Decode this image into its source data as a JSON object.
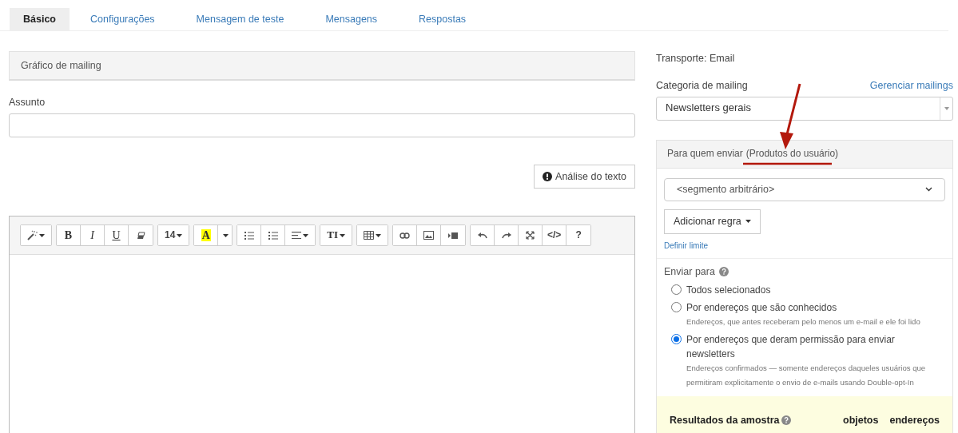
{
  "tabs": [
    {
      "label": "Básico",
      "selected": true
    },
    {
      "label": "Configurações",
      "selected": false
    },
    {
      "label": "Mensagem de teste",
      "selected": false
    },
    {
      "label": "Mensagens",
      "selected": false
    },
    {
      "label": "Respostas",
      "selected": false
    }
  ],
  "graphic_panel": {
    "title": "Gráfico de mailing"
  },
  "subject": {
    "label": "Assunto"
  },
  "analysis_button": {
    "label": "Análise do texto"
  },
  "editor": {
    "toolbar": [
      [
        {
          "kind": "wand",
          "caret": true
        }
      ],
      [
        {
          "kind": "bold",
          "label": "B"
        },
        {
          "kind": "italic",
          "label": "I"
        },
        {
          "kind": "underline",
          "label": "U"
        },
        {
          "kind": "eraser"
        }
      ],
      [
        {
          "kind": "text",
          "label": "14",
          "caret": true
        }
      ],
      [
        {
          "kind": "highlight",
          "label": "A"
        },
        {
          "kind": "caret_only"
        }
      ],
      [
        {
          "kind": "ul"
        },
        {
          "kind": "ol"
        },
        {
          "kind": "align",
          "caret": true
        }
      ],
      [
        {
          "kind": "textsize",
          "label": "TI",
          "caret": true
        }
      ],
      [
        {
          "kind": "table",
          "caret": true
        }
      ],
      [
        {
          "kind": "link"
        },
        {
          "kind": "image"
        },
        {
          "kind": "video"
        }
      ],
      [
        {
          "kind": "undo"
        },
        {
          "kind": "redo"
        },
        {
          "kind": "fullscreen"
        },
        {
          "kind": "text",
          "label": "</>"
        },
        {
          "kind": "text",
          "label": "?"
        }
      ]
    ]
  },
  "transport": "Transporte: Email",
  "category": {
    "label": "Categoria de mailing",
    "link": "Gerenciar mailings",
    "value": "Newsletters gerais"
  },
  "recipients": {
    "title": "Para quem enviar",
    "title_link": "(Produtos do usuário)",
    "segment": "<segmento arbitrário>",
    "add_rule": "Adicionar regra",
    "limit_link": "Definir limite",
    "send_to_label": "Enviar para",
    "options": [
      {
        "label": "Todos selecionados",
        "selected": false
      },
      {
        "label": "Por endereços que são conhecidos",
        "hint": "Endereços, que antes receberam pelo menos um e-mail e ele foi lido",
        "selected": false
      },
      {
        "label": "Por endereços que deram permissão para enviar newsletters",
        "hint": "Endereços confirmados — somente endereços daqueles usuários que permitiram explicitamente o envio de e-mails usando Double-opt-In",
        "selected": true
      }
    ]
  },
  "sample_results": {
    "title": "Resultados da amostra",
    "columns": [
      "objetos",
      "endereços"
    ]
  }
}
